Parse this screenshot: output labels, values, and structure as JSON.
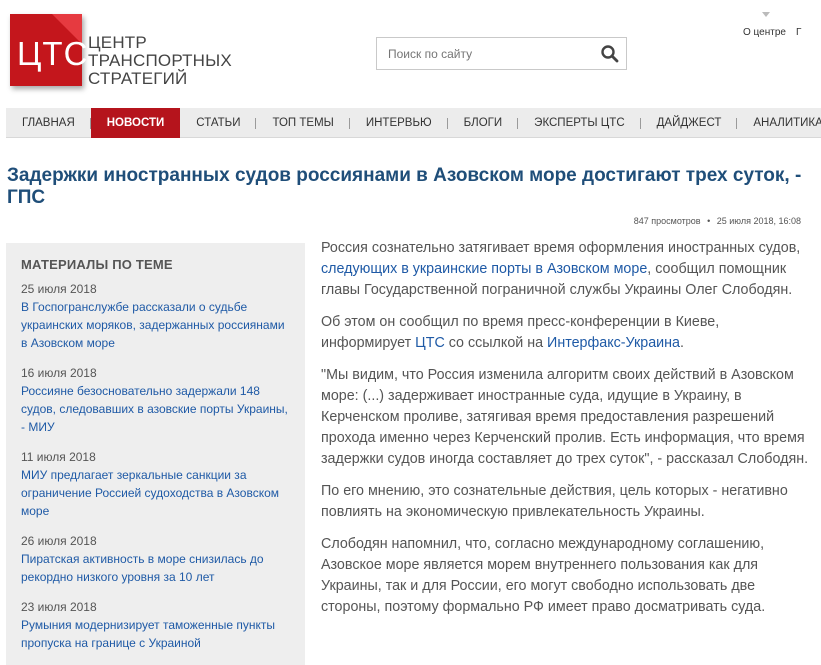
{
  "logo": {
    "mark": "ЦТС",
    "lines": [
      "ЦЕНТР",
      "ТРАНСПОРТНЫХ",
      "СТРАТЕГИЙ"
    ]
  },
  "search": {
    "placeholder": "Поиск по сайту"
  },
  "top_links": [
    "О центре",
    "Г"
  ],
  "nav": [
    {
      "label": "ГЛАВНАЯ",
      "active": false
    },
    {
      "label": "НОВОСТИ",
      "active": true
    },
    {
      "label": "СТАТЬИ",
      "active": false
    },
    {
      "label": "ТОП ТЕМЫ",
      "active": false
    },
    {
      "label": "ИНТЕРВЬЮ",
      "active": false
    },
    {
      "label": "БЛОГИ",
      "active": false
    },
    {
      "label": "ЭКСПЕРТЫ ЦТС",
      "active": false
    },
    {
      "label": "ДАЙДЖЕСТ",
      "active": false
    },
    {
      "label": "АНАЛИТИКА",
      "active": false
    }
  ],
  "article": {
    "title": "Задержки иностранных судов россиянами в Азовском море достигают трех суток, - ГПС",
    "views": "847 просмотров",
    "bullet": "•",
    "date": "25 июля 2018, 16:08",
    "p1_a": "Россия сознательно затягивает время оформления иностранных судов, ",
    "p1_link": "следующих в украинские порты в Азовском море",
    "p1_b": ", сообщил помощник главы Государственной пограничной службы Украины Олег Слободян.",
    "p2_a": "Об этом он сообщил по время пресс-конференции в Киеве, информирует ",
    "p2_link1": "ЦТС",
    "p2_b": " со ссылкой на ",
    "p2_link2": "Интерфакс-Украина",
    "p2_c": ".",
    "p3": "\"Мы видим, что Россия изменила алгоритм своих действий в Азовском море: (...) задерживает иностранные суда, идущие в Украину, в Керченском проливе, затягивая время предоставления разрешений прохода именно через Керченский пролив. Есть информация, что время задержки судов иногда составляет до трех суток\", - рассказал Слободян.",
    "p4": "По его мнению, это сознательные действия, цель которых - негативно повлиять на экономическую привлекательность Украины.",
    "p5": "Слободян напомнил, что, согласно международному соглашению, Азовское море является морем внутреннего пользования как для Украины, так и для России, его могут свободно использовать две стороны, поэтому формально РФ имеет право досматривать суда."
  },
  "sidebar": {
    "heading": "МАТЕРИАЛЫ ПО ТЕМЕ",
    "items": [
      {
        "date": "25 июля 2018",
        "title": "В Госпогранслужбе рассказали о судьбе украинских моряков, задержанных россиянами в Азовском море"
      },
      {
        "date": "16 июля 2018",
        "title": "Россияне безосновательно задержали 148 судов, следовавших в азовские порты Украины, - МИУ"
      },
      {
        "date": "11 июля 2018",
        "title": "МИУ предлагает зеркальные санкции за ограничение Россией судоходства в Азовском море"
      },
      {
        "date": "26 июля 2018",
        "title": "Пиратская активность в море снизилась до рекордно низкого уровня за 10 лет"
      },
      {
        "date": "23 июля 2018",
        "title": "Румыния модернизирует таможенные пункты пропуска на границе с Украиной"
      }
    ]
  },
  "colors": {
    "brand_red": "#c4161c",
    "link_blue": "#1f5aa6",
    "title_blue": "#1f4e79"
  },
  "icons": {
    "search": "magnifier-icon",
    "caret": "caret-down-icon"
  }
}
